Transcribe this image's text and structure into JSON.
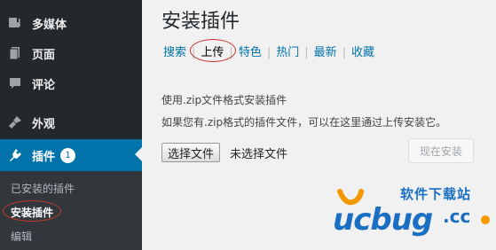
{
  "sidebar": {
    "items": [
      {
        "label": "多媒体",
        "icon": "media-icon"
      },
      {
        "label": "页面",
        "icon": "pages-icon"
      },
      {
        "label": "评论",
        "icon": "comments-icon"
      },
      {
        "label": "外观",
        "icon": "appearance-icon"
      },
      {
        "label": "插件",
        "icon": "plugins-icon",
        "badge": "1"
      }
    ],
    "submenu": [
      {
        "label": "已安装的插件"
      },
      {
        "label": "安装插件"
      },
      {
        "label": "编辑"
      }
    ]
  },
  "main": {
    "title": "安装插件",
    "filters": [
      "搜索",
      "上传",
      "特色",
      "热门",
      "最新",
      "收藏"
    ],
    "desc1": "使用.zip文件格式安装插件",
    "desc2": "如果您有.zip格式的插件文件，可以在这里通过上传安装它。",
    "file_button": "选择文件",
    "file_status": "未选择文件",
    "install_button": "现在安装"
  },
  "watermark": {
    "tagline": "软件下载站",
    "brand": "ucbug",
    "domain": ".cc"
  },
  "colors": {
    "sidebar_bg": "#23282d",
    "submenu_bg": "#32373c",
    "active_bg": "#0073aa",
    "link": "#0073aa",
    "highlight_circle": "#c0392b",
    "watermark_blue": "#1b6fc2",
    "watermark_orange": "#f39800"
  }
}
